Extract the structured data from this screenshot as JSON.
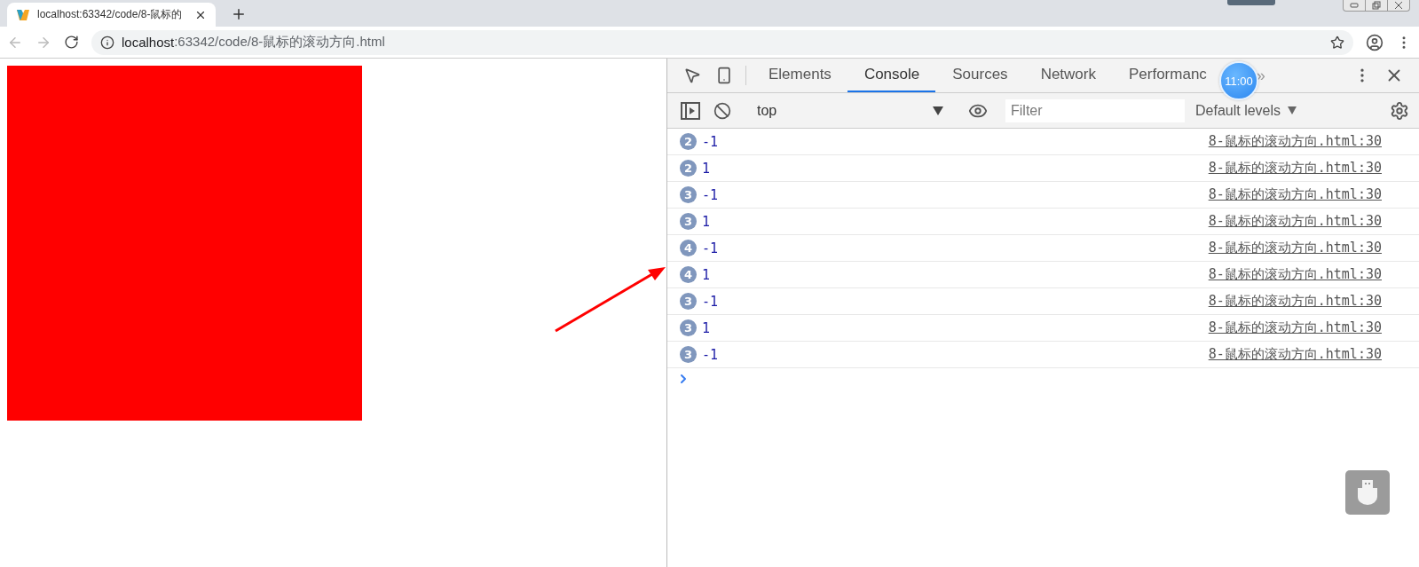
{
  "browser": {
    "tab": {
      "title": "localhost:63342/code/8-鼠标的"
    },
    "address": {
      "host": "localhost",
      "path": ":63342/code/8-鼠标的滚动方向.html"
    }
  },
  "devtools": {
    "tabs": [
      {
        "label": "Elements",
        "selected": false
      },
      {
        "label": "Console",
        "selected": true
      },
      {
        "label": "Sources",
        "selected": false
      },
      {
        "label": "Network",
        "selected": false
      },
      {
        "label": "Performanc",
        "selected": false
      }
    ],
    "more": "»",
    "context": "top",
    "filter": {
      "placeholder": "Filter"
    },
    "levels": "Default levels",
    "messages": [
      {
        "count": "2",
        "text": "-1",
        "source": "8-鼠标的滚动方向.html:30"
      },
      {
        "count": "2",
        "text": "1",
        "source": "8-鼠标的滚动方向.html:30"
      },
      {
        "count": "3",
        "text": "-1",
        "source": "8-鼠标的滚动方向.html:30"
      },
      {
        "count": "3",
        "text": "1",
        "source": "8-鼠标的滚动方向.html:30"
      },
      {
        "count": "4",
        "text": "-1",
        "source": "8-鼠标的滚动方向.html:30"
      },
      {
        "count": "4",
        "text": "1",
        "source": "8-鼠标的滚动方向.html:30"
      },
      {
        "count": "3",
        "text": "-1",
        "source": "8-鼠标的滚动方向.html:30"
      },
      {
        "count": "3",
        "text": "1",
        "source": "8-鼠标的滚动方向.html:30"
      },
      {
        "count": "3",
        "text": "-1",
        "source": "8-鼠标的滚动方向.html:30"
      }
    ]
  },
  "clock": "11:00"
}
